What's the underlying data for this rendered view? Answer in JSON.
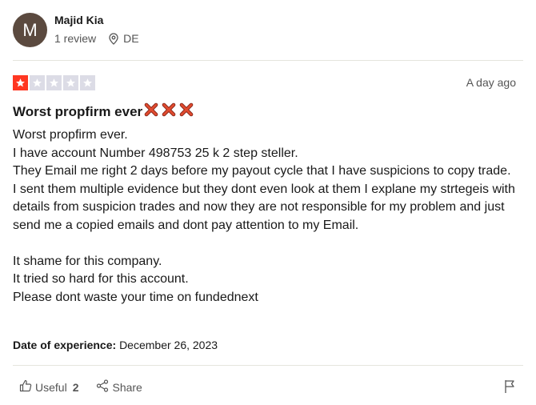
{
  "reviewer": {
    "initial": "M",
    "name": "Majid Kia",
    "reviews": "1 review",
    "country": "DE"
  },
  "review": {
    "rating": 1,
    "max_rating": 5,
    "date": "A day ago",
    "title": "Worst propfirm ever",
    "title_emoji_count": 3,
    "body_lines": [
      "Worst propfirm ever.",
      "I have account Number 498753 25 k 2 step steller.",
      "They Email me right 2 days before my payout cycle that I have suspicions to copy trade.",
      "I sent them multiple evidence but they dont even look at them I explane my strtegeis with details from suspicion trades and now they are not responsible for my problem and just send me a copied emails and dont pay attention to my Email.",
      "",
      "It shame for this company.",
      "It tried so hard for this account.",
      "Please dont waste your time on fundednext"
    ],
    "experience_label": "Date of experience:",
    "experience_date": "December 26, 2023"
  },
  "actions": {
    "useful_label": "Useful",
    "useful_count": "2",
    "share_label": "Share"
  },
  "colors": {
    "star_filled": "#ff3722",
    "star_empty": "#dcdce6",
    "avatar_bg": "#5b4a3f",
    "emoji_x": "#e04b2f"
  }
}
